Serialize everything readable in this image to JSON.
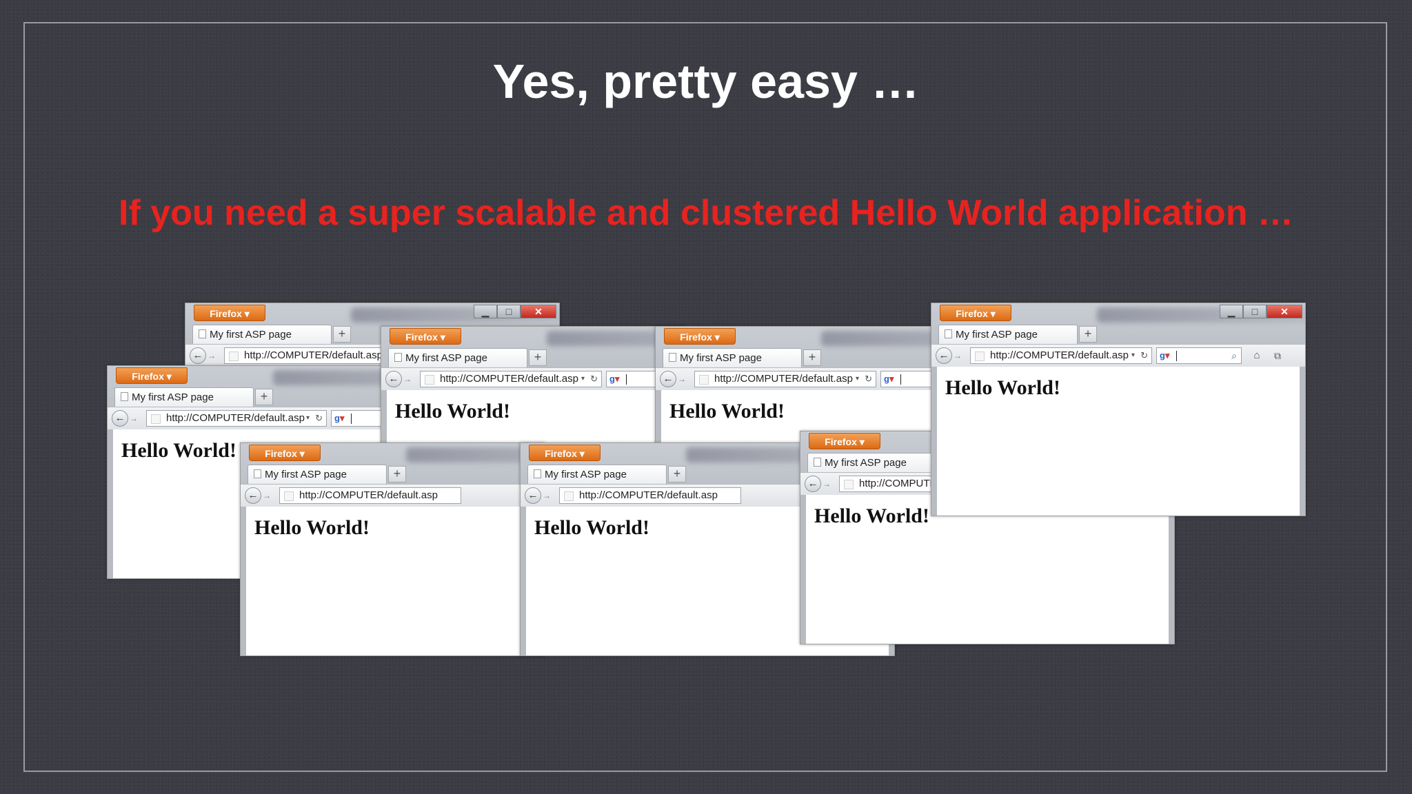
{
  "slide": {
    "title": "Yes, pretty easy …",
    "subtitle": "If you need a super scalable and clustered Hello World application …"
  },
  "browser": {
    "app_button": "Firefox ▾",
    "tab_title": "My first ASP page",
    "new_tab": "+",
    "url": "http://COMPUTER/default.asp",
    "url_short": "http://COMPUTER",
    "page_heading": "Hello World!",
    "icons": {
      "back": "back-arrow-icon",
      "forward": "forward-arrow-icon",
      "reload": "reload-icon",
      "search_engine": "google-icon",
      "search": "magnifier-icon",
      "home": "home-icon",
      "minimize": "minimize-icon",
      "maximize": "maximize-icon",
      "close": "close-icon"
    }
  },
  "colors": {
    "title": "#ffffff",
    "subtitle": "#e8231f",
    "firefox_button": "#e07820",
    "background": "#3c3c44"
  }
}
